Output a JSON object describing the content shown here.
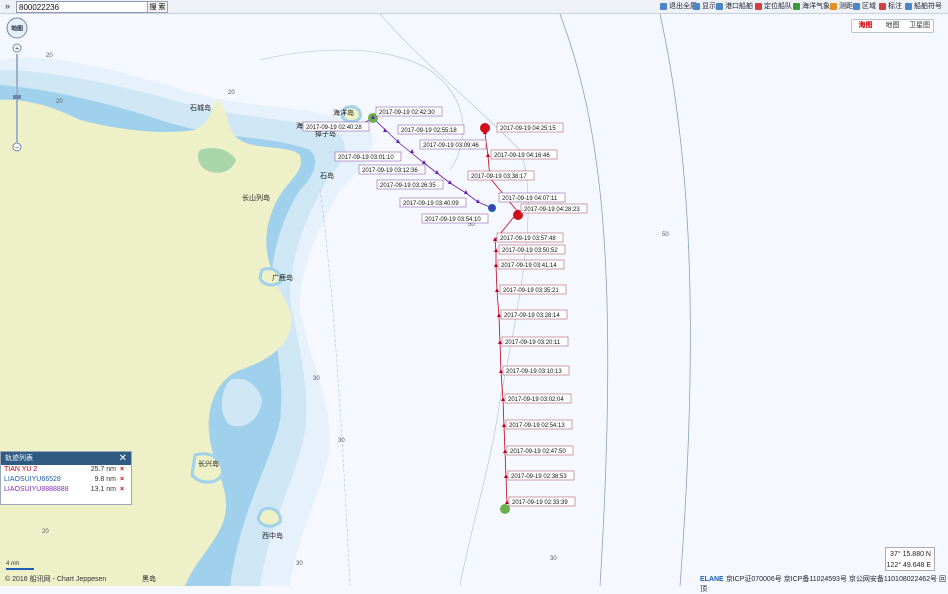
{
  "search": {
    "value": "800022236",
    "button": "搜 索"
  },
  "toolbar": {
    "items": [
      {
        "label": "退出全屏",
        "color": "#4a86c8"
      },
      {
        "label": "显示",
        "color": "#4a86c8"
      },
      {
        "label": "港口船舶",
        "color": "#4a86c8"
      },
      {
        "label": "定位船队",
        "color": "#d04040"
      },
      {
        "label": "海洋气象",
        "color": "#3a9a3a"
      },
      {
        "label": "测距",
        "color": "#e09020"
      },
      {
        "label": "区域",
        "color": "#4a86c8"
      },
      {
        "label": "标注",
        "color": "#d04040"
      },
      {
        "label": "船舶符号",
        "color": "#4a86c8"
      }
    ]
  },
  "layers": {
    "tabs": [
      "海图",
      "地图",
      "卫星图"
    ],
    "active": 0
  },
  "nav": {
    "compass": "地图"
  },
  "map": {
    "place_labels": [
      "海洋岛",
      "獐子岛",
      "石城岛",
      "广鹿岛",
      "长兴岛",
      "西中岛",
      "黑岛",
      "石岛",
      "海王九岛",
      "长山列岛"
    ],
    "depth_labels": [
      "20",
      "20",
      "50",
      "50",
      "30",
      "30",
      "20",
      "30",
      "20",
      "30"
    ],
    "track_purple": {
      "color": "#6a1fb0",
      "labels": [
        "2017-09-19 02:42:30",
        "2017-09-19 02:55:18",
        "2017-09-19 03:09:46",
        "2017-09-19 03:01:10",
        "2017-09-19 03:12:36",
        "2017-09-19 03:26:35",
        "2017-09-19 03:40:09",
        "2017-09-19 03:54:10",
        "2017-09-19 04:07:11",
        "2017-09-19 02:40:28"
      ]
    },
    "track_red": {
      "color": "#c0001a",
      "labels": [
        "2017-09-19 04:25:15",
        "2017-09-19 04:16:46",
        "2017-09-19 03:38:17",
        "2017-09-19 04:28:23",
        "2017-09-19 03:57:48",
        "2017-09-19 03:50:52",
        "2017-09-19 03:41:14",
        "2017-09-19 03:35:21",
        "2017-09-19 03:28:14",
        "2017-09-19 03:20:11",
        "2017-09-19 03:10:13",
        "2017-09-19 03:02:04",
        "2017-09-19 02:54:13",
        "2017-09-19 02:47:50",
        "2017-09-19 02:38:53",
        "2017-09-19 02:33:39"
      ]
    }
  },
  "track_panel": {
    "title": "轨迹列表",
    "rows": [
      {
        "name": "TIAN YU 2",
        "dist": "25.7 nm",
        "color": "#c0001a"
      },
      {
        "name": "LIAOSUIYU66528",
        "dist": "9.8 nm",
        "color": "#1d5db5"
      },
      {
        "name": "LIAOSUIYU8888888",
        "dist": "13.1 nm",
        "color": "#7a2fb0"
      }
    ]
  },
  "coords": {
    "lat": "37° 15.880 N",
    "lon": "122° 49.648 E"
  },
  "footer": {
    "left": "© 2016 船讯网 - Chart Jeppesen",
    "right_brand": "ELANE",
    "right": "京ICP证070006号 京ICP备11024593号 京公网安备110108022462号 回顶"
  },
  "scale": {
    "label": "4 nm"
  },
  "colors": {
    "sea": "#f6f8ff",
    "shallow": "#cfe6f5",
    "deep_shallow": "#9fd0ec",
    "land": "#eef0c8",
    "accent_blue": "#1d5db5"
  }
}
